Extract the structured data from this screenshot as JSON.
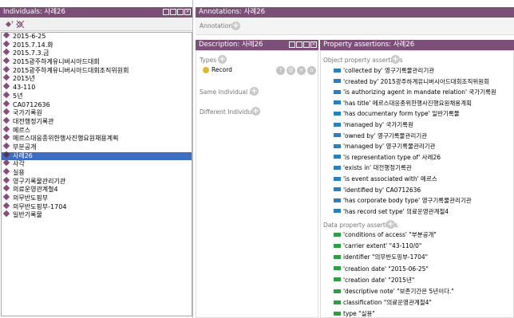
{
  "individuals": {
    "title": "Individuals: 사례26",
    "items": [
      "2015-6-25",
      "2015.7.14.화",
      "2015.7.3.금",
      "2015광주하계유니버시아드대회",
      "2015광주하계유니버시아드대회조직위원회",
      "2015년",
      "43-110",
      "5년",
      "CA0712636",
      "국가기록원",
      "대전행정기록관",
      "메르스",
      "메르스대응종위한행사진행요원채용계획",
      "부분공개",
      "사례26",
      "사각",
      "실용",
      "영구기록물관리기관",
      "의료운영관계철4",
      "의무반도핑부",
      "의무반도핑부-1704",
      "일반기록물"
    ],
    "selected_index": 14
  },
  "annotations": {
    "title": "Annotations: 사례26",
    "label": "Annotations"
  },
  "description": {
    "title": "Description: 사례26",
    "types_label": "Types",
    "type_value": "Record",
    "same_label": "Same Individual As",
    "different_label": "Different Individuals"
  },
  "properties": {
    "title": "Property assertions: 사례26",
    "object_label": "Object property assertions",
    "object_rows": [
      "'collected by'  영구기록물관리기관",
      "'created by'  2015광주하계유니버시아드대회조직위원회",
      "'is authorizing agent in mandate relation'  국가기록원",
      "'has title'  메르스대응종위한행사진행요원채용계획",
      "'has documentary form type'  일반기록물",
      "'managed by'  국가기록원",
      "'owned by'  영구기록물관리기관",
      "'managed by'  영구기록물관리기관",
      "'is representation type of'  사례26",
      "'exists in'  대전행정기록관",
      "'is event associated with'  메르스",
      "'identified by'  CA0712636",
      "'has corporate body type'  영구기록물관리기관",
      "'has record set type'  의료운영관계철4"
    ],
    "data_label": "Data property assertions",
    "data_rows": [
      "'conditions of access'  \"부분공개\"",
      "'carrier extent'  \"43-110/0\"",
      "identifier  \"의무반도핑부-1704\"",
      "'creation date'  \"2015-06-25\"",
      "'creation date'  \"2015년\"",
      "'descriptive note'  \"보존기간은 5년이다.\"",
      "classification  \"의료운영관계철4\"",
      "type  \"실용\""
    ]
  },
  "colors": {
    "header": "#7b4f78",
    "selection": "#3c6fc4",
    "object_bar": "#2b7fc0",
    "data_bar": "#2ea043",
    "individual_icon": "#8b4a7e"
  }
}
